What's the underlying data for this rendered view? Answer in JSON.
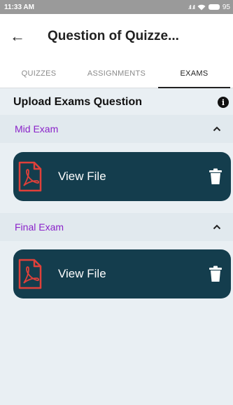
{
  "status_bar": {
    "time": "11:33 AM",
    "signal": ".ıll .ıll",
    "battery": "95"
  },
  "app_bar": {
    "back_glyph": "←",
    "title": "Question of Quizze..."
  },
  "tabs": [
    {
      "label": "QUIZZES",
      "active": false
    },
    {
      "label": "ASSIGNMENTS",
      "active": false
    },
    {
      "label": "EXAMS",
      "active": true
    }
  ],
  "section": {
    "title": "Upload Exams Question",
    "info_glyph": "i"
  },
  "groups": [
    {
      "title": "Mid Exam",
      "expanded": true,
      "file": {
        "label": "View File",
        "icon": "pdf-icon"
      }
    },
    {
      "title": "Final Exam",
      "expanded": true,
      "file": {
        "label": "View File",
        "icon": "pdf-icon"
      }
    }
  ],
  "colors": {
    "card": "#143d4d",
    "group_title": "#8a22c9",
    "pdf_red": "#e0403a",
    "background": "#e9eff3"
  }
}
